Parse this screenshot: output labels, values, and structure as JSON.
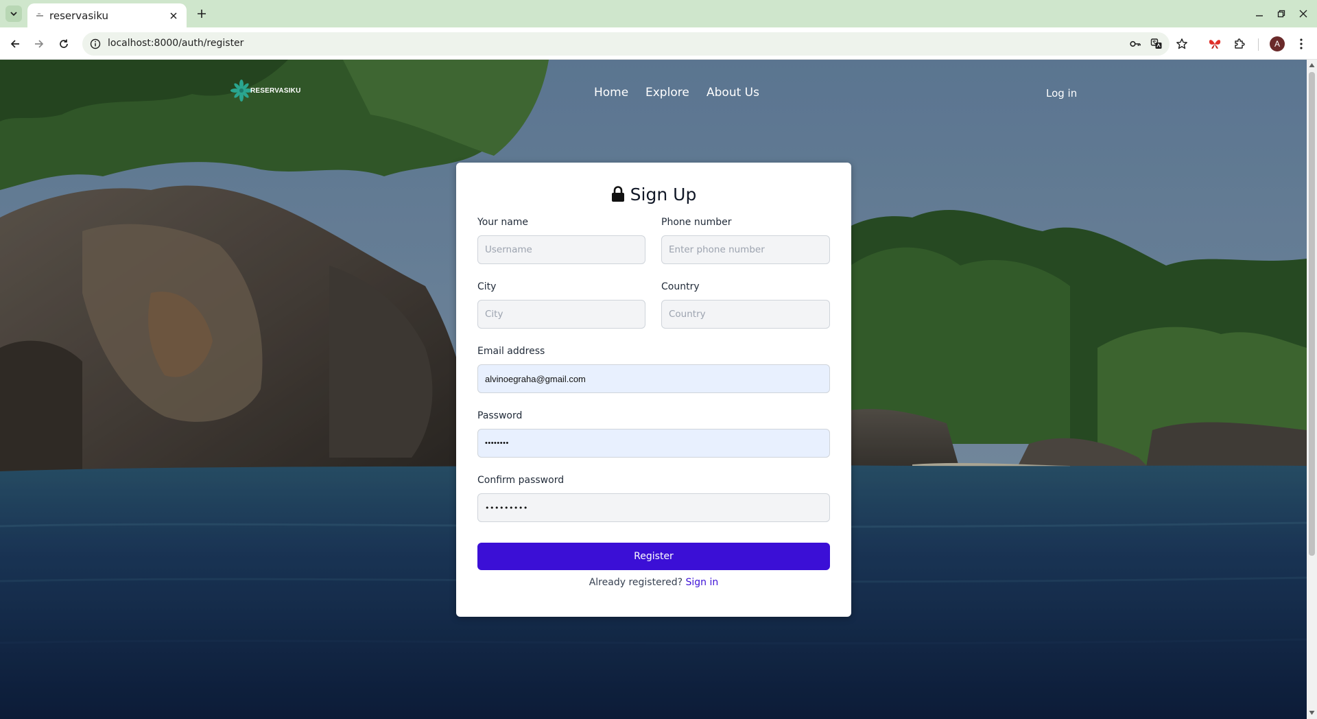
{
  "browser": {
    "tab_title": "reservasiku",
    "url": "localhost:8000/auth/register",
    "avatar_letter": "A"
  },
  "site": {
    "logo_text": "RESERVASIKU",
    "nav": [
      "Home",
      "Explore",
      "About Us"
    ],
    "login_label": "Log in"
  },
  "form": {
    "title": "Sign Up",
    "fields": {
      "name": {
        "label": "Your name",
        "placeholder": "Username",
        "value": ""
      },
      "phone": {
        "label": "Phone number",
        "placeholder": "Enter phone number",
        "value": ""
      },
      "city": {
        "label": "City",
        "placeholder": "City",
        "value": ""
      },
      "country": {
        "label": "Country",
        "placeholder": "Country",
        "value": ""
      },
      "email": {
        "label": "Email address",
        "value": "alvinoegraha@gmail.com"
      },
      "password": {
        "label": "Password",
        "value": "••••••••"
      },
      "confirm": {
        "label": "Confirm password",
        "value": "•••••••••"
      }
    },
    "submit_label": "Register",
    "already_text": "Already registered?",
    "signin_label": "Sign in"
  },
  "colors": {
    "accent": "#3b0fd6",
    "chrome_tab_bar": "#cfe6cc",
    "autofill_bg": "#e8f0fe"
  },
  "icons": [
    "lock-icon",
    "back-icon",
    "forward-icon",
    "reload-icon",
    "info-icon",
    "key-icon",
    "translate-icon",
    "star-icon",
    "extensions-icon",
    "menu-icon"
  ]
}
